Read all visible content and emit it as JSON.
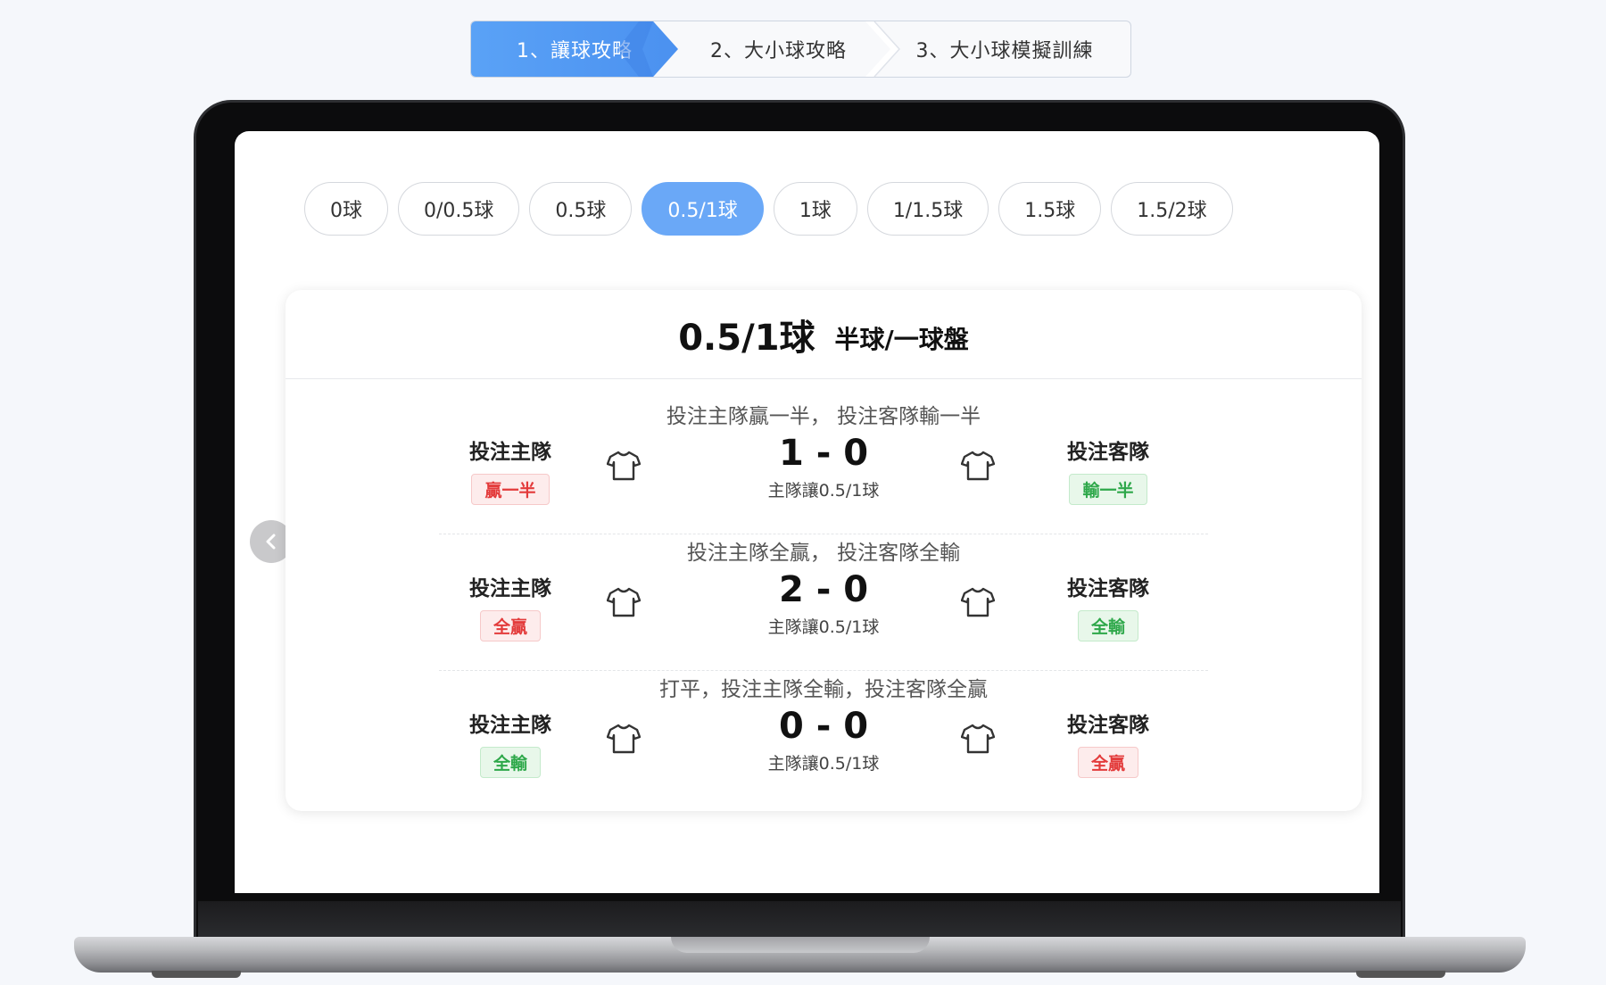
{
  "steps": [
    {
      "label": "1、讓球攻略",
      "active": true
    },
    {
      "label": "2、大小球攻略",
      "active": false
    },
    {
      "label": "3、大小球模擬訓練",
      "active": false
    }
  ],
  "pills": [
    "0球",
    "0/0.5球",
    "0.5球",
    "0.5/1球",
    "1球",
    "1/1.5球",
    "1.5球",
    "1.5/2球"
  ],
  "active_pill": "0.5/1球",
  "card": {
    "title_big": "0.5/1球",
    "title_sub": "半球/一球盤",
    "home_label": "投注主隊",
    "away_label": "投注客隊",
    "rows": [
      {
        "caption": "投注主隊贏一半， 投注客隊輸一半",
        "home_tag": "贏一半",
        "away_tag": "輸一半",
        "score": "1 - 0",
        "note": "主隊讓0.5/1球"
      },
      {
        "caption": "投注主隊全贏， 投注客隊全輸",
        "home_tag": "全贏",
        "away_tag": "全輸",
        "score": "2 - 0",
        "note": "主隊讓0.5/1球"
      },
      {
        "caption": "打平，投注主隊全輸，投注客隊全贏",
        "home_tag": "全輸",
        "away_tag": "全贏",
        "score": "0 - 0",
        "note": "主隊讓0.5/1球"
      }
    ]
  },
  "colors": {
    "accent": "#6aa8f7",
    "win": "#e33b3b",
    "lose": "#2ea84a"
  },
  "icons": {
    "shirt": "shirt-icon",
    "prev": "chevron-left-icon",
    "next": "chevron-right-icon"
  }
}
